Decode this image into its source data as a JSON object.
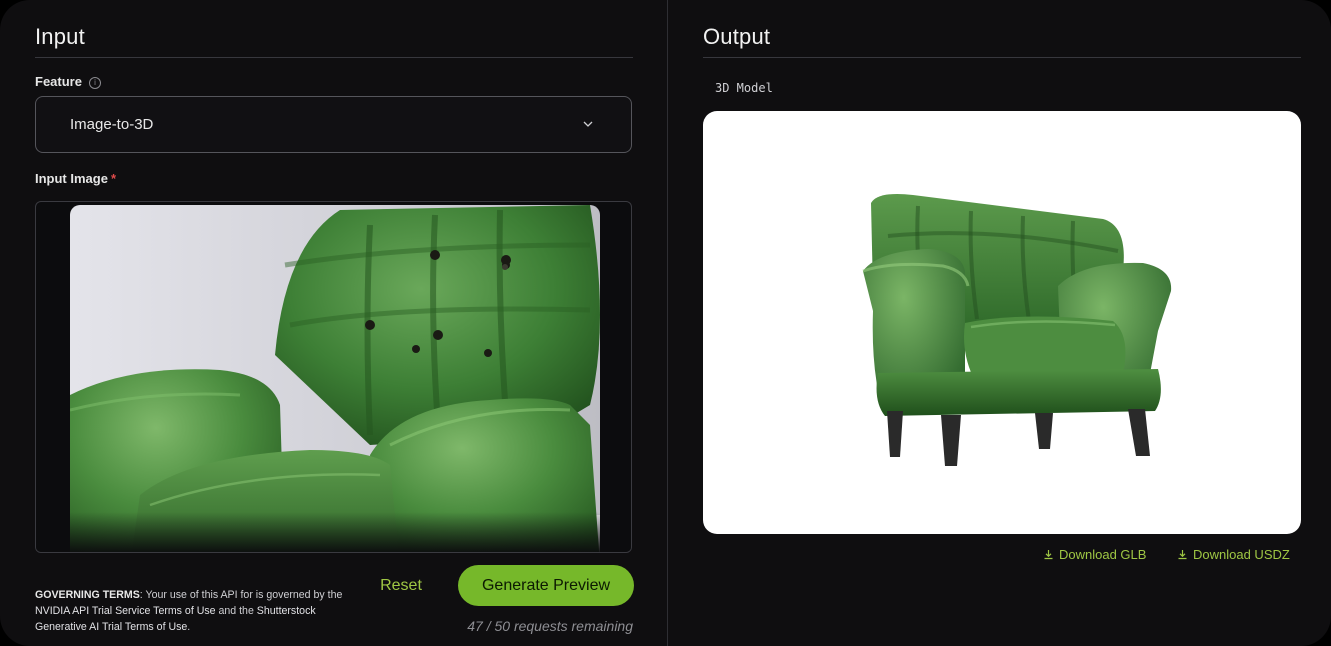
{
  "input": {
    "title": "Input",
    "feature_label": "Feature",
    "feature_info_icon": "info-icon",
    "feature_value": "Image-to-3D",
    "input_image_label": "Input Image",
    "required_mark": "*",
    "image_description": "green tufted leather armchair"
  },
  "terms": {
    "heading": "GOVERNING TERMS",
    "text1": ": Your use of this API for is governed by the ",
    "link1": "NVIDIA API Trial Service Terms of Use",
    "text2": " and the ",
    "link2": "Shutterstock Generative AI Trial Terms of Use",
    "text3": "."
  },
  "actions": {
    "reset_label": "Reset",
    "generate_label": "Generate Preview",
    "remaining": "47 / 50 requests remaining"
  },
  "output": {
    "title": "Output",
    "model_label": "3D Model",
    "download_glb": "Download GLB",
    "download_usdz": "Download USDZ",
    "download_icon": "download-icon"
  },
  "colors": {
    "accent": "#76b82a",
    "accent_text": "#9fc744",
    "leather": "#3c7a34",
    "background": "#0f0e10"
  }
}
